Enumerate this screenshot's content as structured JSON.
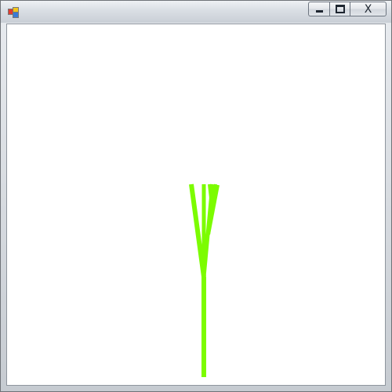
{
  "window": {
    "title": "",
    "icon": "winforms-app-icon",
    "controls": {
      "minimize_icon": "minimize-icon",
      "maximize_icon": "maximize-icon",
      "close_label": "X"
    }
  },
  "canvas": {
    "background": "#ffffff",
    "stroke_color": "#7cfc00"
  }
}
